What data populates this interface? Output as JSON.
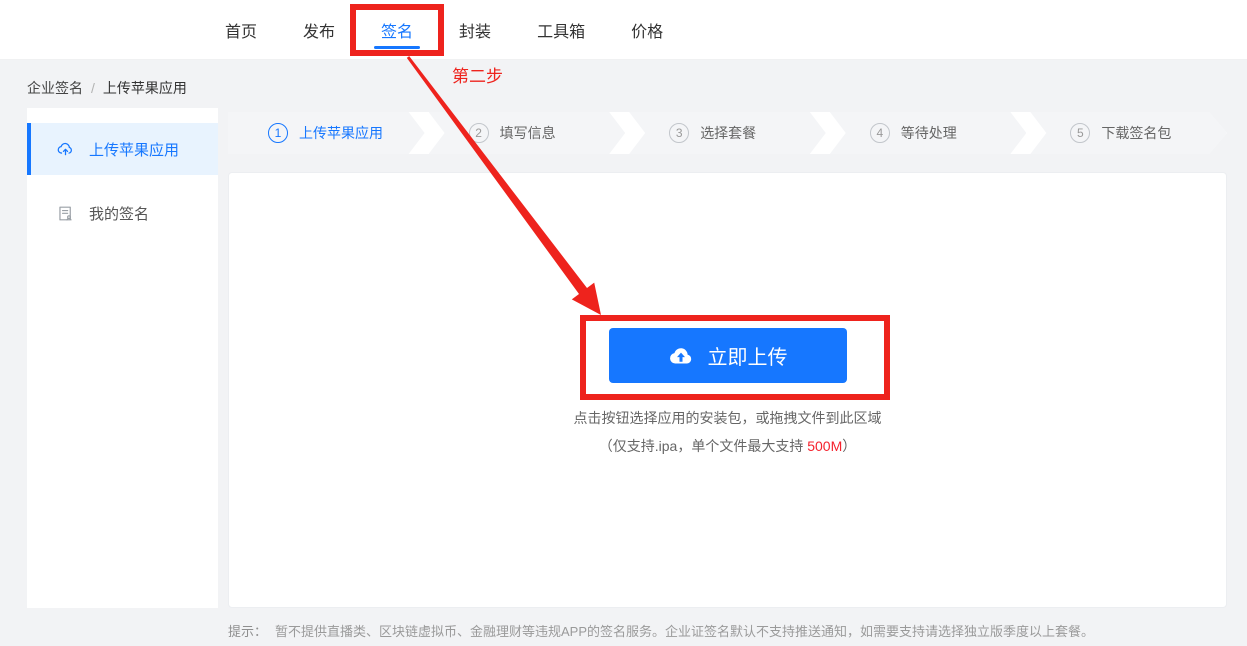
{
  "nav": {
    "items": [
      {
        "label": "首页",
        "active": false
      },
      {
        "label": "发布",
        "active": false
      },
      {
        "label": "签名",
        "active": true
      },
      {
        "label": "封装",
        "active": false
      },
      {
        "label": "工具箱",
        "active": false
      },
      {
        "label": "价格",
        "active": false
      }
    ]
  },
  "annotations": {
    "step_note": "第二步"
  },
  "breadcrumb": {
    "root": "企业签名",
    "separator": "/",
    "current": "上传苹果应用"
  },
  "sidebar": {
    "items": [
      {
        "label": "上传苹果应用",
        "icon": "cloud-upload-icon",
        "active": true
      },
      {
        "label": "我的签名",
        "icon": "signature-file-icon",
        "active": false
      }
    ]
  },
  "steps": [
    {
      "num": "1",
      "label": "上传苹果应用",
      "active": true
    },
    {
      "num": "2",
      "label": "填写信息",
      "active": false
    },
    {
      "num": "3",
      "label": "选择套餐",
      "active": false
    },
    {
      "num": "4",
      "label": "等待处理",
      "active": false
    },
    {
      "num": "5",
      "label": "下载签名包",
      "active": false
    }
  ],
  "upload": {
    "button_label": "立即上传",
    "hint_line1": "点击按钮选择应用的安装包，或拖拽文件到此区域",
    "hint_line2_prefix": "（仅支持.ipa，单个文件最大支持 ",
    "hint_line2_highlight": "500M",
    "hint_line2_suffix": "）"
  },
  "footer": {
    "tip_label": "提示：",
    "tip_text": "暂不提供直播类、区块链虚拟币、金融理财等违规APP的签名服务。企业证签名默认不支持推送通知，如需要支持请选择独立版季度以上套餐。"
  },
  "colors": {
    "primary_blue": "#1677ff",
    "sidebar_active_bg": "#e8f3fe",
    "annotation_red": "#ee231d",
    "size_limit_red": "#f5222d",
    "page_background": "#f2f3f5"
  }
}
